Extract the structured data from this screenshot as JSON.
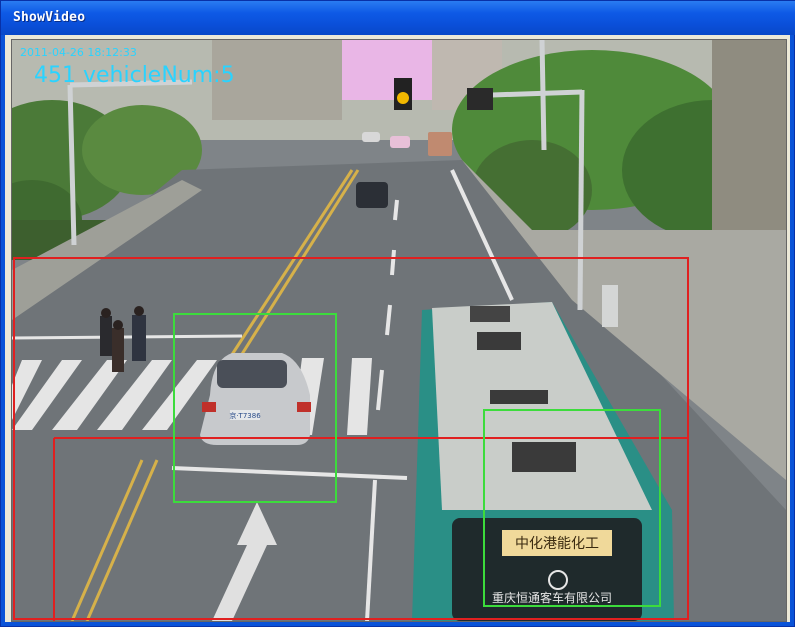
{
  "window": {
    "title": "ShowVideo"
  },
  "video": {
    "timestamp": "2011-04-26 18:12:33",
    "counter_text": "451 vehicleNum:5",
    "bus_sign": "中化港能化工",
    "bus_company": "重庆恒通客车有限公司",
    "plate": "京·T7386",
    "colors": {
      "roi_box": "#e02020",
      "detect_box": "#3cdc3c",
      "overlay_text": "#2ad3ff",
      "bus_body": "#2a8f86"
    }
  }
}
